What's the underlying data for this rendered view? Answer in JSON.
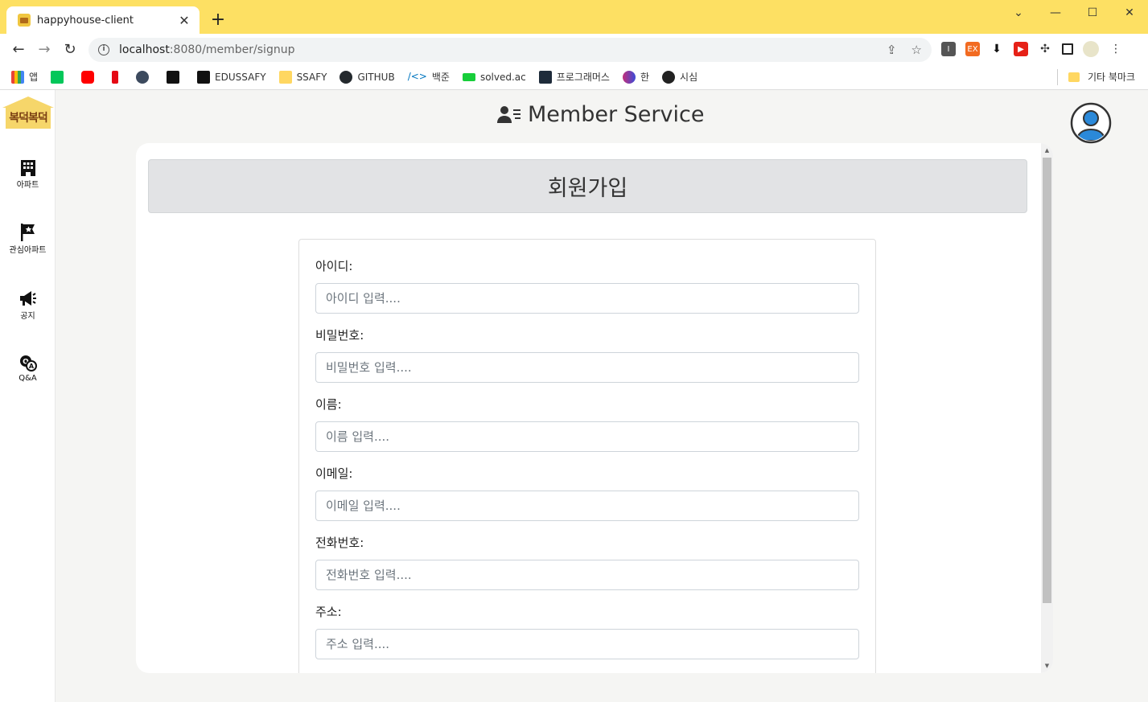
{
  "browser": {
    "tab_title": "happyhouse-client",
    "url_host": "localhost",
    "url_path": ":8080/member/signup",
    "bookmarks": [
      {
        "label": "앱",
        "color": "#4285f4"
      },
      {
        "label": "",
        "color": "#03c75a"
      },
      {
        "label": "",
        "color": "#ff0000"
      },
      {
        "label": "",
        "color": "#e50914"
      },
      {
        "label": "",
        "color": "#3c4a5e"
      },
      {
        "label": "",
        "color": "#111111"
      },
      {
        "label": "EDUSSAFY",
        "color": "#111111"
      },
      {
        "label": "SSAFY",
        "color": "#ffd761"
      },
      {
        "label": "GITHUB",
        "color": "#24292e"
      },
      {
        "label": "백준",
        "color": "#0076c0"
      },
      {
        "label": "solved.ac",
        "color": "#17ce3a"
      },
      {
        "label": "프로그래머스",
        "color": "#1e2b3a"
      },
      {
        "label": "한",
        "color": "#c32f7a"
      },
      {
        "label": "시심",
        "color": "#222222"
      }
    ],
    "other_bookmarks": "기타 북마크"
  },
  "sidebar": {
    "logo_text": "복덕복덕",
    "items": [
      {
        "label": "아파트",
        "icon": "building-icon"
      },
      {
        "label": "관심아파트",
        "icon": "flag-star-icon"
      },
      {
        "label": "공지",
        "icon": "megaphone-icon"
      },
      {
        "label": "Q&A",
        "icon": "qa-comments-icon"
      }
    ]
  },
  "header": {
    "title": "Member Service"
  },
  "signup": {
    "banner": "회원가입",
    "fields": [
      {
        "label": "아이디:",
        "placeholder": "아이디 입력...."
      },
      {
        "label": "비밀번호:",
        "placeholder": "비밀번호 입력...."
      },
      {
        "label": "이름:",
        "placeholder": "이름 입력...."
      },
      {
        "label": "이메일:",
        "placeholder": "이메일 입력...."
      },
      {
        "label": "전화번호:",
        "placeholder": "전화번호 입력...."
      },
      {
        "label": "주소:",
        "placeholder": "주소 입력...."
      }
    ]
  }
}
